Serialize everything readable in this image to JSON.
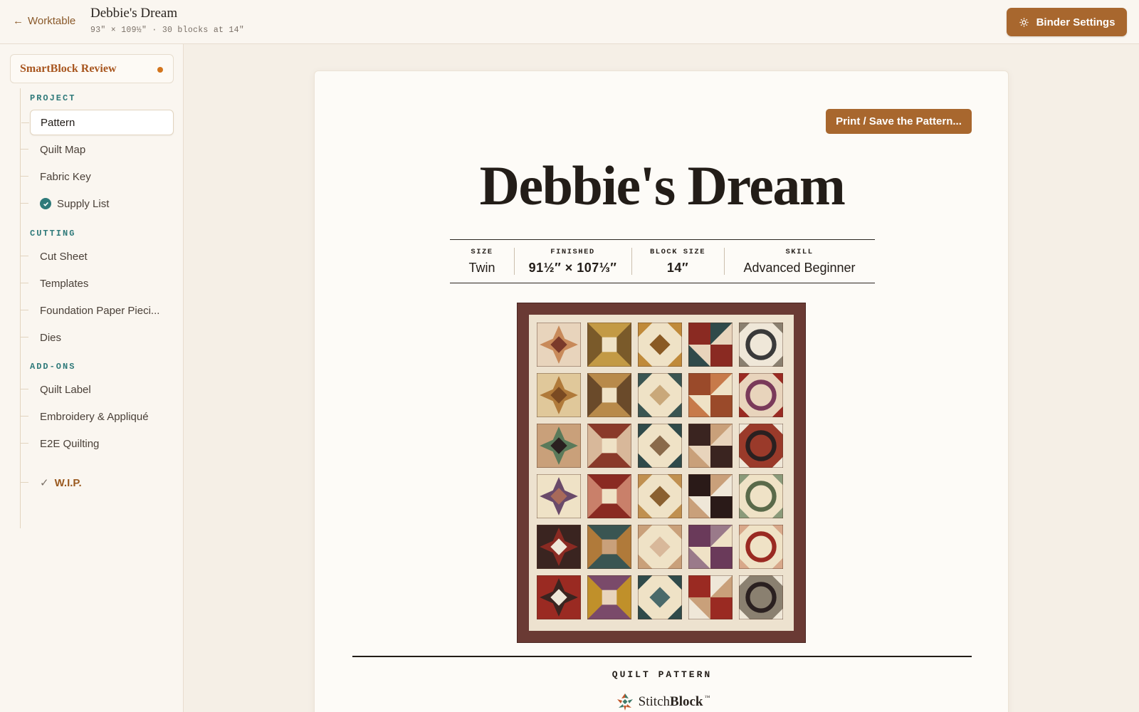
{
  "topbar": {
    "back_label": "Worktable",
    "title": "Debbie's Dream",
    "subtitle": "93″ × 109½″ · 30 blocks at 14″",
    "binder_label": "Binder Settings"
  },
  "sidebar": {
    "review_label": "SmartBlock Review",
    "sections": {
      "project": "PROJECT",
      "cutting": "CUTTING",
      "addons": "ADD-ONS"
    },
    "items": {
      "pattern": "Pattern",
      "quilt_map": "Quilt Map",
      "fabric_key": "Fabric Key",
      "supply_list": "Supply List",
      "cut_sheet": "Cut Sheet",
      "templates": "Templates",
      "fpp": "Foundation Paper Pieci...",
      "dies": "Dies",
      "quilt_label": "Quilt Label",
      "embroidery": "Embroidery & Appliqué",
      "e2e": "E2E Quilting",
      "wip": "W.I.P."
    }
  },
  "paper": {
    "print_label": "Print / Save the Pattern...",
    "title": "Debbie's Dream",
    "specs": {
      "size_label": "SIZE",
      "size_value": "Twin",
      "finished_label": "FINISHED",
      "finished_value": "91½″ × 107⅓″",
      "block_label": "BLOCK SIZE",
      "block_value": "14″",
      "skill_label": "SKILL",
      "skill_value": "Advanced Beginner"
    },
    "footer_label": "QUILT PATTERN",
    "brand": {
      "light": "Stitch",
      "bold": "Block",
      "tm": "™"
    }
  },
  "colors": {
    "accent": "#a8672e",
    "teal": "#2f7a7a",
    "review_orange": "#a8561f",
    "border_fabric": "#6a3a34"
  },
  "icons": {
    "back": "arrow-left-icon",
    "binder": "sun-gear-icon",
    "supply_check": "check-circle-icon",
    "wip_check": "check-icon",
    "brand": "stitchblock-logo-icon"
  }
}
